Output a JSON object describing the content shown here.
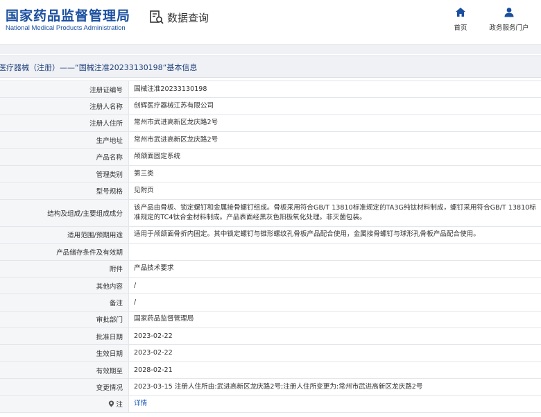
{
  "header": {
    "logo_cn": "国家药品监督管理局",
    "logo_en": "National Medical Products Administration",
    "query_label": "数据查询",
    "nav": {
      "home": "首页",
      "gov": "政务服务门户"
    }
  },
  "breadcrumb": "医疗器械（注册）——“国械注准20233130198”基本信息",
  "rows": [
    {
      "label": "注册证编号",
      "value": "国械注准20233130198"
    },
    {
      "label": "注册人名称",
      "value": "创辉医疗器械江苏有限公司"
    },
    {
      "label": "注册人住所",
      "value": "常州市武进高新区龙庆路2号"
    },
    {
      "label": "生产地址",
      "value": "常州市武进高新区龙庆路2号"
    },
    {
      "label": "产品名称",
      "value": "颅颌面固定系统"
    },
    {
      "label": "管理类别",
      "value": "第三类"
    },
    {
      "label": "型号规格",
      "value": "见附页"
    },
    {
      "label": "结构及组成/主要组成成分",
      "value": "该产品由骨板、锁定螺钉和金属接骨螺钉组成。骨板采用符合GB/T 13810标准规定的TA3G纯钛材料制成，螺钉采用符合GB/T 13810标准规定的TC4钛合金材料制成。产品表面经黑灰色阳极氧化处理。非灭菌包装。"
    },
    {
      "label": "适用范围/预期用途",
      "value": "适用于颅颌面骨折内固定。其中锁定螺钉与锥形螺纹孔骨板产品配合使用，金属接骨螺钉与球形孔骨板产品配合使用。"
    },
    {
      "label": "产品储存条件及有效期",
      "value": ""
    },
    {
      "label": "附件",
      "value": "产品技术要求"
    },
    {
      "label": "其他内容",
      "value": "/"
    },
    {
      "label": "备注",
      "value": "/"
    },
    {
      "label": "审批部门",
      "value": "国家药品监督管理局"
    },
    {
      "label": "批准日期",
      "value": "2023-02-22"
    },
    {
      "label": "生效日期",
      "value": "2023-02-22"
    },
    {
      "label": "有效期至",
      "value": "2028-02-21"
    },
    {
      "label": "变更情况",
      "value": "2023-03-15 注册人住所由:武进高新区龙庆路2号;注册人住所变更为:常州市武进高新区龙庆路2号"
    },
    {
      "label": "注",
      "value": "详情"
    }
  ],
  "colors": {
    "brand": "#1a4fa0",
    "link": "#1a57b8",
    "label_bg": "#f5f6f8"
  },
  "icons": {
    "query": "search-document-icon",
    "home": "home-icon",
    "gov": "user-icon",
    "note": "location-pin-icon"
  }
}
